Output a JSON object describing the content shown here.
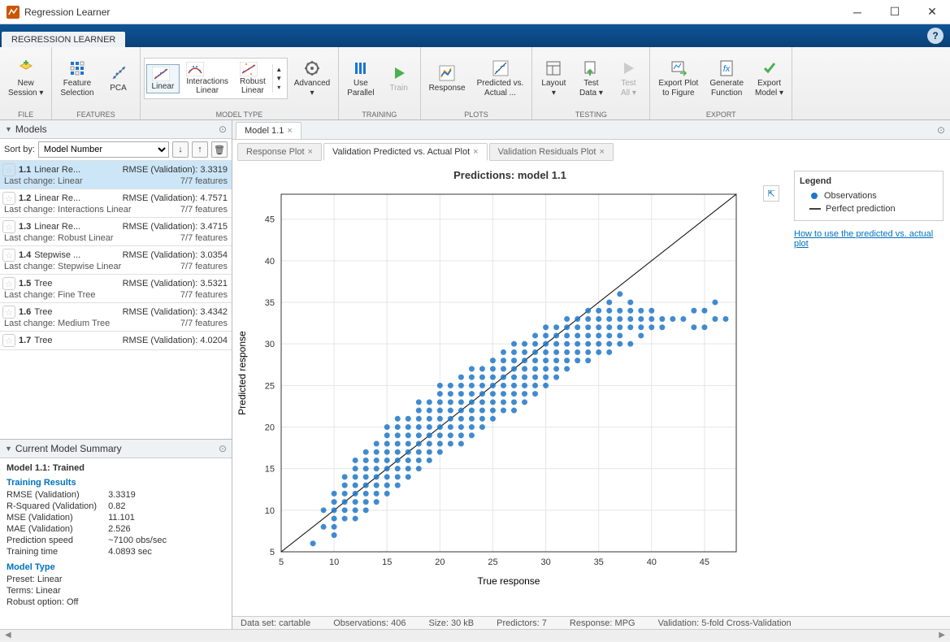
{
  "window": {
    "title": "Regression Learner"
  },
  "ribbon_tab": "REGRESSION LEARNER",
  "toolgroups": [
    {
      "label": "FILE",
      "buttons": [
        {
          "name": "new-session",
          "text": "New\nSession ▾"
        }
      ]
    },
    {
      "label": "FEATURES",
      "buttons": [
        {
          "name": "feature-selection",
          "text": "Feature\nSelection"
        },
        {
          "name": "pca",
          "text": "PCA"
        }
      ]
    },
    {
      "label": "MODEL TYPE",
      "gallery": [
        {
          "name": "linear",
          "text": "Linear",
          "sel": true
        },
        {
          "name": "interactions-linear",
          "text": "Interactions\nLinear"
        },
        {
          "name": "robust-linear",
          "text": "Robust\nLinear"
        }
      ],
      "buttons": [
        {
          "name": "advanced",
          "text": "Advanced\n▾"
        }
      ]
    },
    {
      "label": "TRAINING",
      "buttons": [
        {
          "name": "use-parallel",
          "text": "Use\nParallel"
        },
        {
          "name": "train",
          "text": "Train",
          "disabled": true
        }
      ]
    },
    {
      "label": "PLOTS",
      "buttons": [
        {
          "name": "response-plot",
          "text": "Response"
        },
        {
          "name": "predicted-vs-actual",
          "text": "Predicted vs.\nActual   ..."
        }
      ]
    },
    {
      "label": "TESTING",
      "buttons": [
        {
          "name": "layout",
          "text": "Layout\n▾"
        },
        {
          "name": "test-data",
          "text": "Test\nData ▾"
        },
        {
          "name": "test-all",
          "text": "Test\nAll ▾",
          "disabled": true
        }
      ]
    },
    {
      "label": "EXPORT",
      "buttons": [
        {
          "name": "export-plot",
          "text": "Export Plot\nto Figure"
        },
        {
          "name": "generate-function",
          "text": "Generate\nFunction"
        },
        {
          "name": "export-model",
          "text": "Export\nModel ▾"
        }
      ]
    }
  ],
  "models_panel": {
    "title": "Models",
    "sort_label": "Sort by:",
    "sort_value": "Model Number",
    "items": [
      {
        "id": "1.1",
        "type": "Linear Re...",
        "metric": "RMSE (Validation): 3.3319",
        "lc": "Last change: Linear",
        "feat": "7/7 features",
        "sel": true
      },
      {
        "id": "1.2",
        "type": "Linear Re...",
        "metric": "RMSE (Validation): 4.7571",
        "lc": "Last change: Interactions Linear",
        "feat": "7/7 features"
      },
      {
        "id": "1.3",
        "type": "Linear Re...",
        "metric": "RMSE (Validation): 3.4715",
        "lc": "Last change: Robust Linear",
        "feat": "7/7 features"
      },
      {
        "id": "1.4",
        "type": "Stepwise ...",
        "metric": "RMSE (Validation): 3.0354",
        "lc": "Last change: Stepwise Linear",
        "feat": "7/7 features"
      },
      {
        "id": "1.5",
        "type": "Tree",
        "metric": "RMSE (Validation): 3.5321",
        "lc": "Last change: Fine Tree",
        "feat": "7/7 features"
      },
      {
        "id": "1.6",
        "type": "Tree",
        "metric": "RMSE (Validation): 3.4342",
        "lc": "Last change: Medium Tree",
        "feat": "7/7 features"
      },
      {
        "id": "1.7",
        "type": "Tree",
        "metric": "RMSE (Validation): 4.0204",
        "lc": "",
        "feat": ""
      }
    ]
  },
  "summary": {
    "title": "Current Model Summary",
    "model_line": "Model 1.1: Trained",
    "training_hdr": "Training Results",
    "rows": [
      [
        "RMSE (Validation)",
        "3.3319"
      ],
      [
        "R-Squared (Validation)",
        "0.82"
      ],
      [
        "MSE (Validation)",
        "11.101"
      ],
      [
        "MAE (Validation)",
        "2.526"
      ],
      [
        "Prediction speed",
        "~7100 obs/sec"
      ],
      [
        "Training time",
        "4.0893 sec"
      ]
    ],
    "modeltype_hdr": "Model Type",
    "rows2": [
      [
        "Preset:",
        "Linear"
      ],
      [
        "Terms:",
        "Linear"
      ],
      [
        "Robust option:",
        "Off"
      ]
    ]
  },
  "doc_tab": "Model 1.1",
  "plot_tabs": [
    {
      "label": "Response Plot",
      "active": false
    },
    {
      "label": "Validation Predicted vs. Actual Plot",
      "active": true
    },
    {
      "label": "Validation Residuals Plot",
      "active": false
    }
  ],
  "plot": {
    "title": "Predictions: model 1.1",
    "xlabel": "True response",
    "ylabel": "Predicted response"
  },
  "legend": {
    "title": "Legend",
    "obs": "Observations",
    "perfect": "Perfect prediction",
    "help_link": "How to use the predicted vs. actual plot"
  },
  "status": {
    "dataset": "Data set: cartable",
    "observations": "Observations: 406",
    "size": "Size: 30 kB",
    "predictors": "Predictors: 7",
    "response": "Response: MPG",
    "validation": "Validation: 5-fold Cross-Validation"
  },
  "chart_data": {
    "type": "scatter",
    "title": "Predictions: model 1.1",
    "xlabel": "True response",
    "ylabel": "Predicted response",
    "xlim": [
      5,
      48
    ],
    "ylim": [
      5,
      48
    ],
    "xticks": [
      5,
      10,
      15,
      20,
      25,
      30,
      35,
      40,
      45
    ],
    "yticks": [
      5,
      10,
      15,
      20,
      25,
      30,
      35,
      40,
      45
    ],
    "series": [
      {
        "name": "Observations",
        "marker": "circle",
        "color": "#1f77c8",
        "points": [
          [
            8,
            6
          ],
          [
            9,
            8
          ],
          [
            9,
            10
          ],
          [
            10,
            8
          ],
          [
            10,
            10
          ],
          [
            10,
            11
          ],
          [
            10,
            12
          ],
          [
            10,
            9
          ],
          [
            10,
            7
          ],
          [
            11,
            9
          ],
          [
            11,
            11
          ],
          [
            11,
            12
          ],
          [
            11,
            13
          ],
          [
            11,
            14
          ],
          [
            11,
            10
          ],
          [
            12,
            10
          ],
          [
            12,
            11
          ],
          [
            12,
            12
          ],
          [
            12,
            13
          ],
          [
            12,
            14
          ],
          [
            12,
            15
          ],
          [
            12,
            16
          ],
          [
            12,
            9
          ],
          [
            13,
            11
          ],
          [
            13,
            12
          ],
          [
            13,
            13
          ],
          [
            13,
            14
          ],
          [
            13,
            15
          ],
          [
            13,
            16
          ],
          [
            13,
            17
          ],
          [
            13,
            10
          ],
          [
            14,
            12
          ],
          [
            14,
            13
          ],
          [
            14,
            14
          ],
          [
            14,
            15
          ],
          [
            14,
            16
          ],
          [
            14,
            17
          ],
          [
            14,
            18
          ],
          [
            14,
            11
          ],
          [
            15,
            12
          ],
          [
            15,
            13
          ],
          [
            15,
            14
          ],
          [
            15,
            15
          ],
          [
            15,
            16
          ],
          [
            15,
            17
          ],
          [
            15,
            18
          ],
          [
            15,
            19
          ],
          [
            15,
            20
          ],
          [
            16,
            13
          ],
          [
            16,
            14
          ],
          [
            16,
            15
          ],
          [
            16,
            16
          ],
          [
            16,
            17
          ],
          [
            16,
            18
          ],
          [
            16,
            19
          ],
          [
            16,
            20
          ],
          [
            16,
            21
          ],
          [
            17,
            14
          ],
          [
            17,
            15
          ],
          [
            17,
            16
          ],
          [
            17,
            17
          ],
          [
            17,
            18
          ],
          [
            17,
            19
          ],
          [
            17,
            20
          ],
          [
            17,
            21
          ],
          [
            18,
            15
          ],
          [
            18,
            16
          ],
          [
            18,
            17
          ],
          [
            18,
            18
          ],
          [
            18,
            19
          ],
          [
            18,
            20
          ],
          [
            18,
            21
          ],
          [
            18,
            22
          ],
          [
            18,
            23
          ],
          [
            19,
            16
          ],
          [
            19,
            17
          ],
          [
            19,
            18
          ],
          [
            19,
            19
          ],
          [
            19,
            20
          ],
          [
            19,
            21
          ],
          [
            19,
            22
          ],
          [
            19,
            23
          ],
          [
            20,
            17
          ],
          [
            20,
            18
          ],
          [
            20,
            19
          ],
          [
            20,
            20
          ],
          [
            20,
            21
          ],
          [
            20,
            22
          ],
          [
            20,
            23
          ],
          [
            20,
            24
          ],
          [
            20,
            25
          ],
          [
            21,
            18
          ],
          [
            21,
            19
          ],
          [
            21,
            20
          ],
          [
            21,
            21
          ],
          [
            21,
            22
          ],
          [
            21,
            23
          ],
          [
            21,
            24
          ],
          [
            21,
            25
          ],
          [
            22,
            18
          ],
          [
            22,
            19
          ],
          [
            22,
            20
          ],
          [
            22,
            21
          ],
          [
            22,
            22
          ],
          [
            22,
            23
          ],
          [
            22,
            24
          ],
          [
            22,
            25
          ],
          [
            22,
            26
          ],
          [
            23,
            19
          ],
          [
            23,
            20
          ],
          [
            23,
            21
          ],
          [
            23,
            22
          ],
          [
            23,
            23
          ],
          [
            23,
            24
          ],
          [
            23,
            25
          ],
          [
            23,
            26
          ],
          [
            23,
            27
          ],
          [
            24,
            20
          ],
          [
            24,
            21
          ],
          [
            24,
            22
          ],
          [
            24,
            23
          ],
          [
            24,
            24
          ],
          [
            24,
            25
          ],
          [
            24,
            26
          ],
          [
            24,
            27
          ],
          [
            25,
            21
          ],
          [
            25,
            22
          ],
          [
            25,
            23
          ],
          [
            25,
            24
          ],
          [
            25,
            25
          ],
          [
            25,
            26
          ],
          [
            25,
            27
          ],
          [
            25,
            28
          ],
          [
            26,
            22
          ],
          [
            26,
            23
          ],
          [
            26,
            24
          ],
          [
            26,
            25
          ],
          [
            26,
            26
          ],
          [
            26,
            27
          ],
          [
            26,
            28
          ],
          [
            26,
            29
          ],
          [
            27,
            22
          ],
          [
            27,
            23
          ],
          [
            27,
            24
          ],
          [
            27,
            25
          ],
          [
            27,
            26
          ],
          [
            27,
            27
          ],
          [
            27,
            28
          ],
          [
            27,
            29
          ],
          [
            27,
            30
          ],
          [
            28,
            23
          ],
          [
            28,
            24
          ],
          [
            28,
            25
          ],
          [
            28,
            26
          ],
          [
            28,
            27
          ],
          [
            28,
            28
          ],
          [
            28,
            29
          ],
          [
            28,
            30
          ],
          [
            29,
            24
          ],
          [
            29,
            25
          ],
          [
            29,
            26
          ],
          [
            29,
            27
          ],
          [
            29,
            28
          ],
          [
            29,
            29
          ],
          [
            29,
            30
          ],
          [
            29,
            31
          ],
          [
            30,
            25
          ],
          [
            30,
            26
          ],
          [
            30,
            27
          ],
          [
            30,
            28
          ],
          [
            30,
            29
          ],
          [
            30,
            30
          ],
          [
            30,
            31
          ],
          [
            30,
            32
          ],
          [
            31,
            26
          ],
          [
            31,
            27
          ],
          [
            31,
            28
          ],
          [
            31,
            29
          ],
          [
            31,
            30
          ],
          [
            31,
            31
          ],
          [
            31,
            32
          ],
          [
            32,
            27
          ],
          [
            32,
            28
          ],
          [
            32,
            29
          ],
          [
            32,
            30
          ],
          [
            32,
            31
          ],
          [
            32,
            32
          ],
          [
            32,
            33
          ],
          [
            33,
            28
          ],
          [
            33,
            29
          ],
          [
            33,
            30
          ],
          [
            33,
            31
          ],
          [
            33,
            32
          ],
          [
            33,
            33
          ],
          [
            34,
            28
          ],
          [
            34,
            29
          ],
          [
            34,
            30
          ],
          [
            34,
            31
          ],
          [
            34,
            32
          ],
          [
            34,
            33
          ],
          [
            34,
            34
          ],
          [
            35,
            29
          ],
          [
            35,
            30
          ],
          [
            35,
            31
          ],
          [
            35,
            32
          ],
          [
            35,
            33
          ],
          [
            35,
            34
          ],
          [
            36,
            29
          ],
          [
            36,
            30
          ],
          [
            36,
            31
          ],
          [
            36,
            32
          ],
          [
            36,
            33
          ],
          [
            36,
            34
          ],
          [
            36,
            35
          ],
          [
            37,
            30
          ],
          [
            37,
            31
          ],
          [
            37,
            32
          ],
          [
            37,
            33
          ],
          [
            37,
            34
          ],
          [
            37,
            36
          ],
          [
            38,
            30
          ],
          [
            38,
            32
          ],
          [
            38,
            33
          ],
          [
            38,
            34
          ],
          [
            38,
            35
          ],
          [
            39,
            31
          ],
          [
            39,
            32
          ],
          [
            39,
            33
          ],
          [
            39,
            34
          ],
          [
            40,
            32
          ],
          [
            40,
            33
          ],
          [
            40,
            34
          ],
          [
            41,
            32
          ],
          [
            41,
            33
          ],
          [
            42,
            33
          ],
          [
            43,
            33
          ],
          [
            44,
            34
          ],
          [
            44,
            32
          ],
          [
            45,
            34
          ],
          [
            45,
            32
          ],
          [
            46,
            33
          ],
          [
            46,
            35
          ],
          [
            47,
            33
          ]
        ]
      },
      {
        "name": "Perfect prediction",
        "type": "line",
        "color": "#000",
        "points": [
          [
            5,
            5
          ],
          [
            48,
            48
          ]
        ]
      }
    ]
  }
}
